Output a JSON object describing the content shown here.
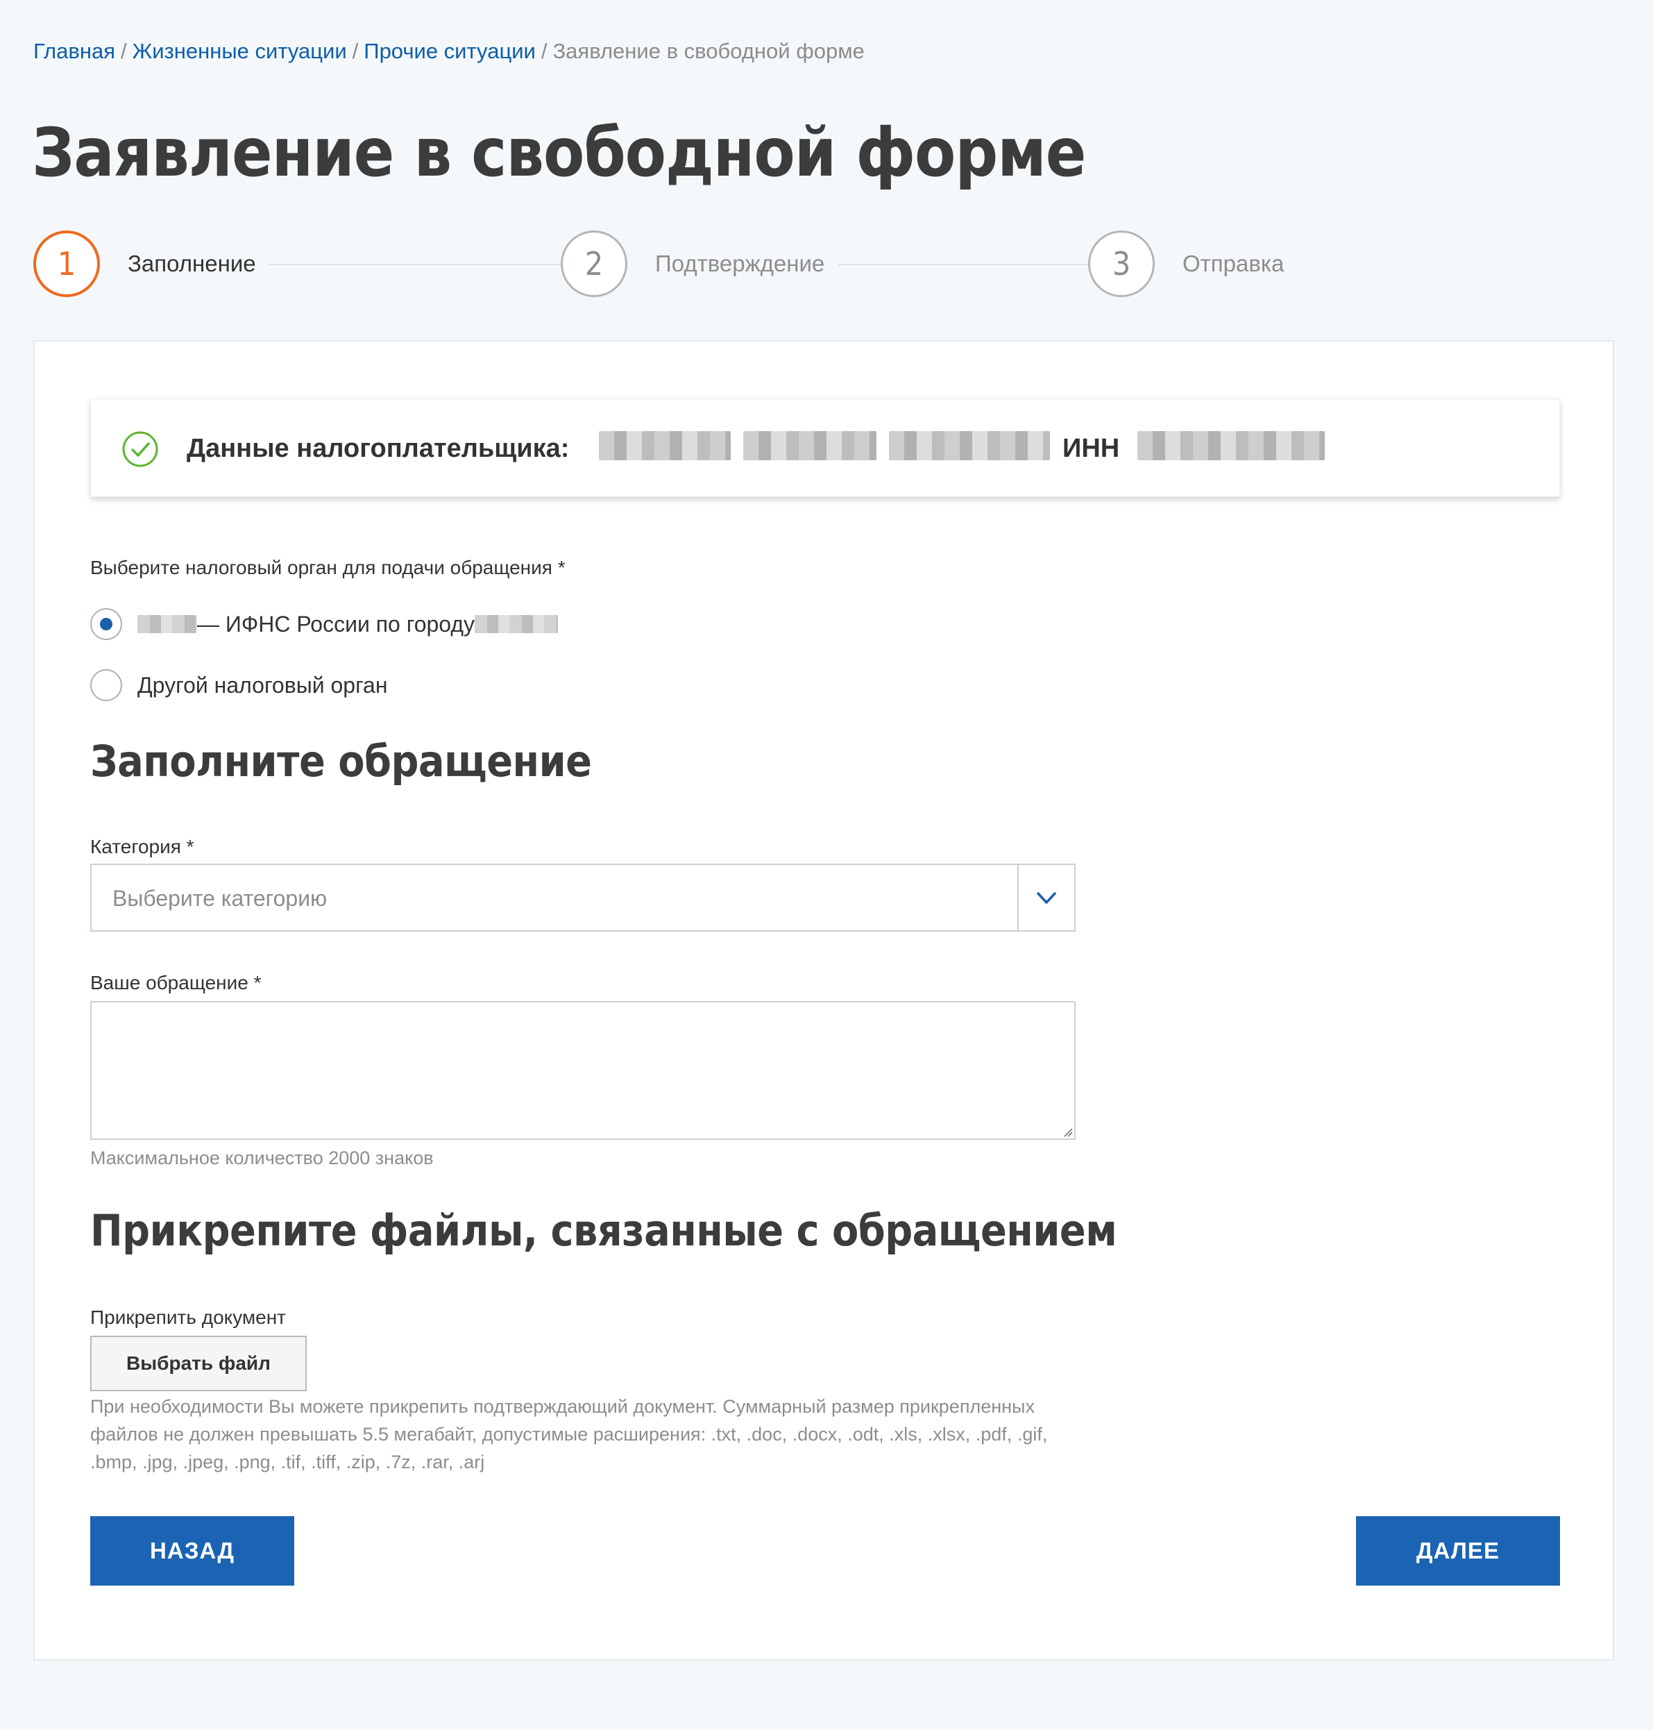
{
  "breadcrumb": {
    "items": [
      "Главная",
      "Жизненные ситуации",
      "Прочие ситуации"
    ],
    "separator": "/",
    "current": "Заявление в свободной форме"
  },
  "page": {
    "title": "Заявление в свободной форме"
  },
  "steps": [
    {
      "number": "1",
      "label": "Заполнение",
      "active": true
    },
    {
      "number": "2",
      "label": "Подтверждение",
      "active": false
    },
    {
      "number": "3",
      "label": "Отправка",
      "active": false
    }
  ],
  "taxpayer": {
    "label": "Данные налогоплательщика:",
    "inn_label": "ИНН"
  },
  "tax_office": {
    "label": "Выберите налоговый орган для подачи обращения *",
    "options": [
      {
        "text": "— ИФНС России по городу",
        "selected": true
      },
      {
        "text": "Другой налоговый орган",
        "selected": false
      }
    ]
  },
  "appeal": {
    "section_title": "Заполните обращение",
    "category_label": "Категория *",
    "category_placeholder": "Выберите категорию",
    "text_label": "Ваше обращение *",
    "text_value": "",
    "text_hint": "Максимальное количество 2000 знаков"
  },
  "files": {
    "section_title": "Прикрепите файлы, связанные с обращением",
    "attach_label": "Прикрепить документ",
    "button_label": "Выбрать файл",
    "hint_lines": [
      "При необходимости Вы можете прикрепить подтверждающий документ. Суммарный размер прикрепленных",
      "файлов не должен превышать 5.5 мегабайт, допустимые расширения: .txt, .doc, .docx, .odt, .xls, .xlsx, .pdf, .gif,",
      ".bmp, .jpg, .jpeg, .png, .tif, .tiff, .zip, .7z, .rar, .arj"
    ]
  },
  "actions": {
    "back_label": "НАЗАД",
    "next_label": "ДАЛЕЕ"
  },
  "colors": {
    "accent_orange": "#ee6a1f",
    "primary_blue": "#1b64b4",
    "link_blue": "#0d5ea8",
    "success_green": "#5cb531",
    "background": "#f4f8fa"
  },
  "icons": {
    "success": "check-circle-icon",
    "dropdown": "chevron-down-icon",
    "resize": "resize-grip-icon"
  }
}
